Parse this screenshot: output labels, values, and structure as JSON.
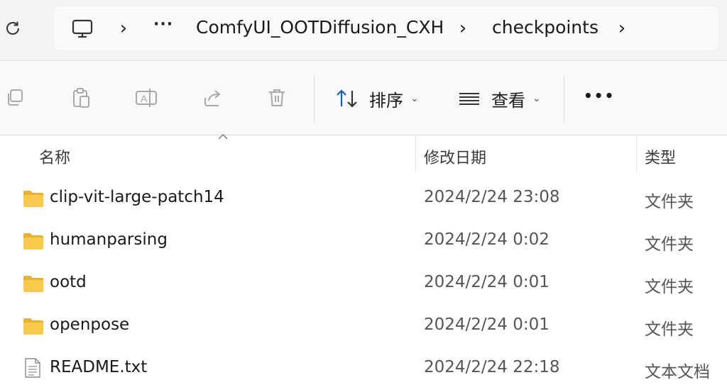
{
  "address_bar": {
    "overflow": "···",
    "breadcrumbs": [
      "ComfyUI_OOTDiffusion_CXH",
      "checkpoints"
    ]
  },
  "toolbar": {
    "sort_label": "排序",
    "view_label": "查看",
    "more_label": "•••"
  },
  "columns": {
    "name": "名称",
    "date": "修改日期",
    "type": "类型"
  },
  "files": [
    {
      "name": "clip-vit-large-patch14",
      "date": "2024/2/24 23:08",
      "type": "文件夹",
      "icon": "folder-icon"
    },
    {
      "name": "humanparsing",
      "date": "2024/2/24 0:02",
      "type": "文件夹",
      "icon": "folder-icon"
    },
    {
      "name": "ootd",
      "date": "2024/2/24 0:01",
      "type": "文件夹",
      "icon": "folder-icon"
    },
    {
      "name": "openpose",
      "date": "2024/2/24 0:01",
      "type": "文件夹",
      "icon": "folder-icon"
    },
    {
      "name": "README.txt",
      "date": "2024/2/24 22:18",
      "type": "文本文档",
      "icon": "text-file-icon"
    }
  ],
  "colors": {
    "folder": "#f8c94a",
    "folder_dark": "#e9b332",
    "disabled_icon": "#a8a8a8",
    "accent_sort": "#1a5fb4"
  }
}
